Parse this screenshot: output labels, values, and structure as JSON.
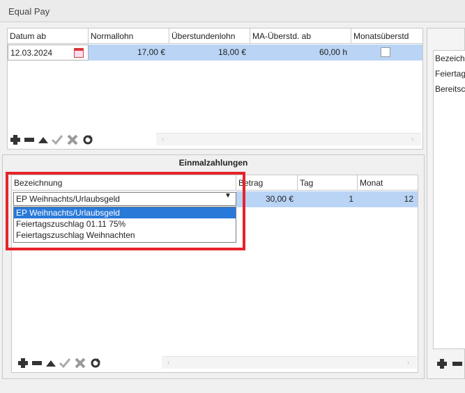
{
  "window": {
    "title": "Equal Pay"
  },
  "top_grid": {
    "columns": [
      "Datum ab",
      "Normallohn",
      "Überstundenlohn",
      "MA-Überstd. ab",
      "Monatsüberstd"
    ],
    "row": {
      "datum": "12.03.2024",
      "normallohn": "17,00 €",
      "ueberstundenlohn": "18,00 €",
      "ma_ueberstd": "60,00 h",
      "monatsueberstd": false
    }
  },
  "right_panel": {
    "items": [
      "Bezeich",
      "Feiertag",
      "Bereitsc"
    ]
  },
  "einmal": {
    "title": "Einmalzahlungen",
    "columns": [
      "Bezeichnung",
      "Betrag",
      "Tag",
      "Monat"
    ],
    "row": {
      "bezeichnung": "EP Weihnachts/Urlaubsgeld",
      "betrag": "30,00 €",
      "tag": "1",
      "monat": "12"
    },
    "dropdown_options": [
      "EP Weihnachts/Urlaubsgeld",
      "Feiertagszuschlag 01.11 75%",
      "Feiertagszuschlag Weihnachten"
    ]
  },
  "colors": {
    "highlight": "#e5242b",
    "selection": "#2979d8",
    "row_bg": "#b9d4f5"
  }
}
